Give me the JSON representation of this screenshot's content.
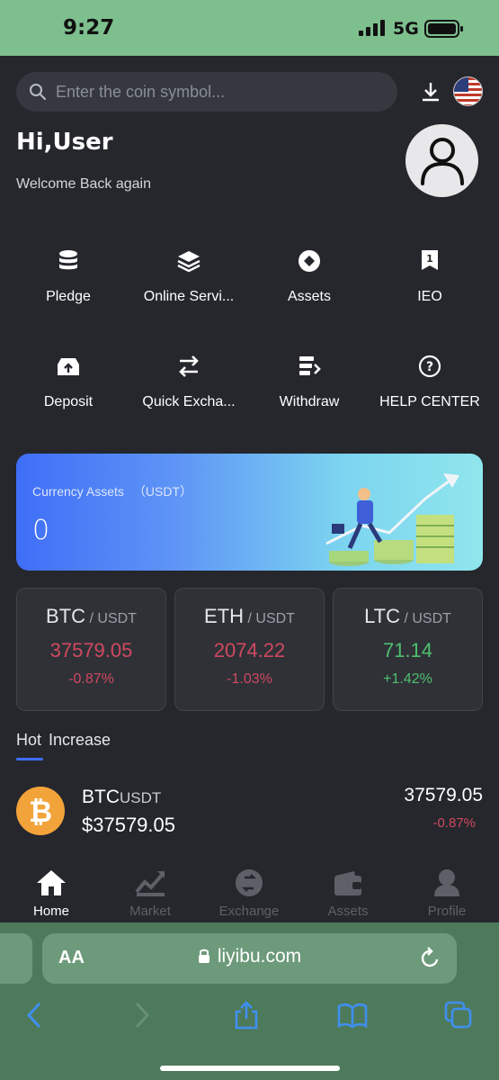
{
  "status_bar": {
    "time": "9:27",
    "network": "5G"
  },
  "search": {
    "placeholder": "Enter the coin symbol..."
  },
  "greeting": {
    "title": "Hi,User",
    "subtitle": "Welcome Back again"
  },
  "menu": [
    {
      "label": "Pledge",
      "icon": "coins-stack-icon"
    },
    {
      "label": "Online Servi...",
      "icon": "layers-icon"
    },
    {
      "label": "Assets",
      "icon": "diamond-icon"
    },
    {
      "label": "IEO",
      "icon": "ticket-icon"
    },
    {
      "label": "Deposit",
      "icon": "deposit-box-icon"
    },
    {
      "label": "Quick Excha...",
      "icon": "swap-arrows-icon"
    },
    {
      "label": "Withdraw",
      "icon": "withdraw-icon"
    },
    {
      "label": "HELP CENTER",
      "icon": "help-circle-icon"
    }
  ],
  "banner": {
    "title": "Currency Assets",
    "unit": "（USDT）",
    "value": "0"
  },
  "tickers": [
    {
      "base": "BTC",
      "quote": " / USDT",
      "price": "37579.05",
      "change": "-0.87%",
      "direction": "down"
    },
    {
      "base": "ETH",
      "quote": " / USDT",
      "price": "2074.22",
      "change": "-1.03%",
      "direction": "down"
    },
    {
      "base": "LTC",
      "quote": " / USDT",
      "price": "71.14",
      "change": "+1.42%",
      "direction": "up"
    }
  ],
  "tabs": [
    "Hot",
    "Increase"
  ],
  "list": [
    {
      "base": "BTC",
      "quote": "USDT",
      "usd_price": "$37579.05",
      "price": "37579.05",
      "change": "-0.87%",
      "icon": "bitcoin-icon"
    }
  ],
  "bottom_nav": [
    {
      "label": "Home",
      "icon": "home-icon",
      "active": true
    },
    {
      "label": "Market",
      "icon": "chart-icon",
      "active": false
    },
    {
      "label": "Exchange",
      "icon": "exchange-icon",
      "active": false
    },
    {
      "label": "Assets",
      "icon": "wallet-icon",
      "active": false
    },
    {
      "label": "Profile",
      "icon": "profile-icon",
      "active": false
    }
  ],
  "browser": {
    "aa_label": "AA",
    "url": "liyibu.com"
  },
  "colors": {
    "accent": "#3f6ef7",
    "down": "#d0495f",
    "up": "#4ec06e",
    "background": "#25272d"
  }
}
